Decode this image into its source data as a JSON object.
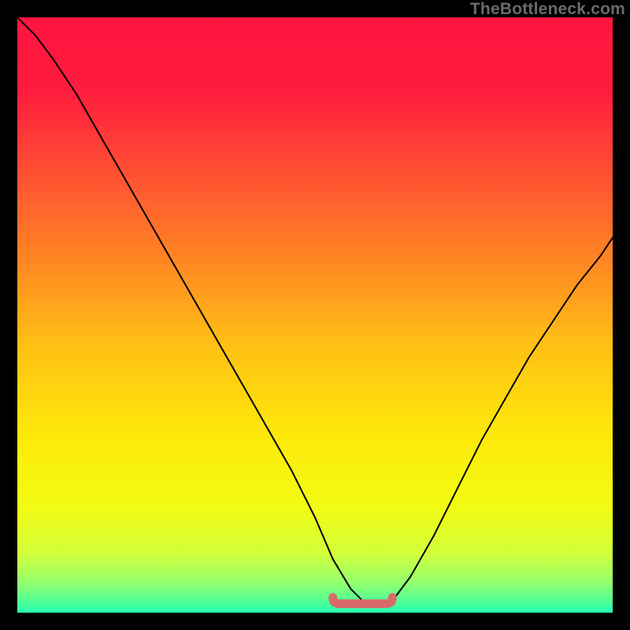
{
  "watermark": "TheBottleneck.com",
  "colors": {
    "gradient_stops": [
      {
        "offset": 0.0,
        "color": "#ff153f"
      },
      {
        "offset": 0.12,
        "color": "#ff1b3e"
      },
      {
        "offset": 0.25,
        "color": "#ff4b34"
      },
      {
        "offset": 0.4,
        "color": "#ff8324"
      },
      {
        "offset": 0.55,
        "color": "#ffc014"
      },
      {
        "offset": 0.7,
        "color": "#fde80a"
      },
      {
        "offset": 0.82,
        "color": "#f3fb12"
      },
      {
        "offset": 0.9,
        "color": "#d2ff3a"
      },
      {
        "offset": 0.95,
        "color": "#93ff6e"
      },
      {
        "offset": 0.985,
        "color": "#46ff9a"
      },
      {
        "offset": 1.0,
        "color": "#26ffb0"
      }
    ],
    "curve": "#000000",
    "bottom_marker": "#d96a6a",
    "background": "#000000"
  },
  "chart_data": {
    "type": "line",
    "title": "",
    "xlabel": "",
    "ylabel": "",
    "xlim": [
      0,
      100
    ],
    "ylim": [
      0,
      100
    ],
    "annotations": [
      "TheBottleneck.com"
    ],
    "bottom_marker": {
      "x_start": 53,
      "x_end": 63,
      "y": 1.5
    },
    "series": [
      {
        "name": "bottleneck-curve",
        "x": [
          0,
          3,
          6,
          10,
          14,
          18,
          22,
          26,
          30,
          34,
          38,
          42,
          46,
          50,
          53,
          56,
          58,
          60,
          62,
          63,
          66,
          70,
          74,
          78,
          82,
          86,
          90,
          94,
          98,
          100
        ],
        "y": [
          100,
          97,
          93,
          87,
          80,
          73,
          66,
          59,
          52,
          45,
          38,
          31,
          24,
          16,
          9,
          4,
          2,
          1,
          1,
          2,
          6,
          13,
          21,
          29,
          36,
          43,
          49,
          55,
          60,
          63
        ]
      }
    ]
  }
}
